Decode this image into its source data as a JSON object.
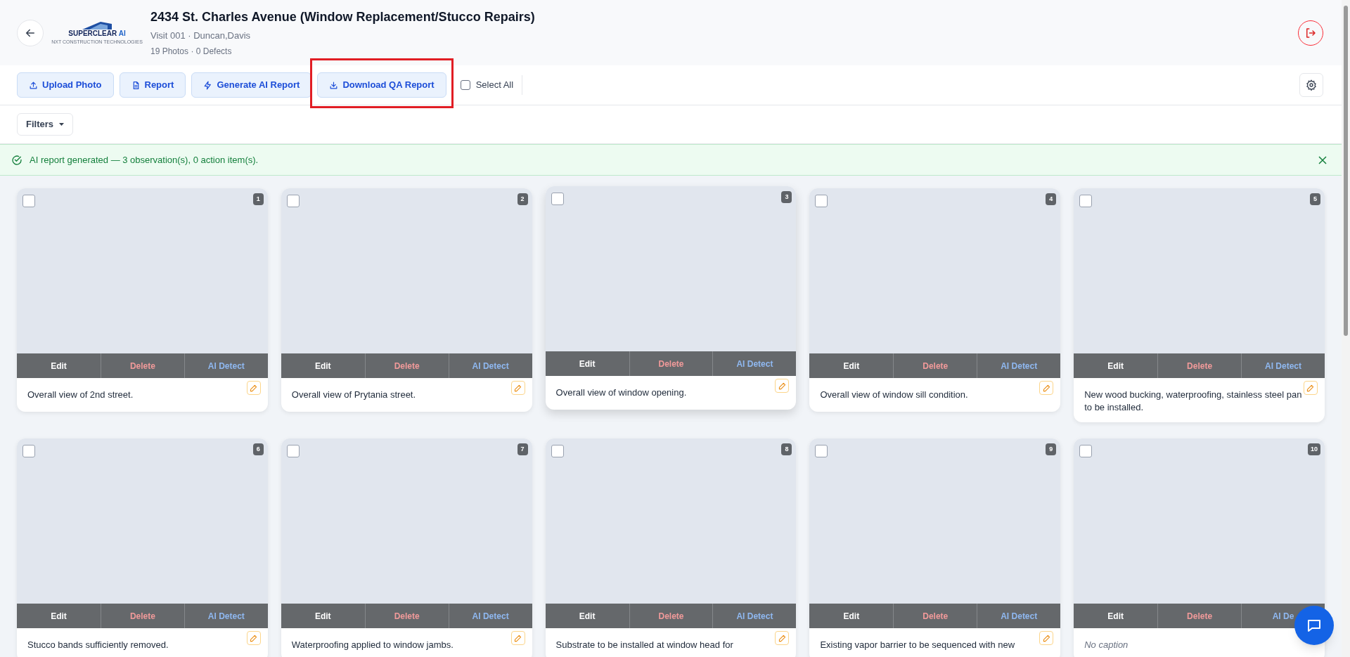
{
  "header": {
    "title": "2434 St. Charles Avenue (Window Replacement/Stucco Repairs)",
    "subtitle": "Visit 001 · Duncan,Davis",
    "stats": "19 Photos · 0 Defects",
    "logo": {
      "name": "SUPERCLEAR",
      "suffix": "AI",
      "tagline": "NXT CONSTRUCTION TECHNOLOGIES"
    }
  },
  "toolbar": {
    "buttons": [
      {
        "label": "Upload Photo",
        "kind": "upload",
        "highlighted": false
      },
      {
        "label": "Report",
        "kind": "document",
        "highlighted": false
      },
      {
        "label": "Generate AI Report",
        "kind": "bolt",
        "highlighted": false
      },
      {
        "label": "Download QA Report",
        "kind": "download",
        "highlighted": true
      }
    ],
    "select_all": {
      "label": "Select All",
      "checked": false
    }
  },
  "filters": {
    "label": "Filters"
  },
  "banner": {
    "kind": "success",
    "message": "AI report generated — 3 observation(s), 0 action item(s)."
  },
  "photos": [
    {
      "number": "1",
      "checked": false,
      "raised": false,
      "caption": "Overall view of 2nd street.",
      "caption_missing": false,
      "edit_icon": true,
      "actions": [
        {
          "kind": "edit",
          "label": "Edit"
        },
        {
          "kind": "delete",
          "label": "Delete"
        },
        {
          "kind": "detect",
          "label": "AI Detect"
        }
      ]
    },
    {
      "number": "2",
      "checked": false,
      "raised": false,
      "caption": "Overall view of Prytania street.",
      "caption_missing": false,
      "edit_icon": true,
      "actions": [
        {
          "kind": "edit",
          "label": "Edit"
        },
        {
          "kind": "delete",
          "label": "Delete"
        },
        {
          "kind": "detect",
          "label": "AI Detect"
        }
      ]
    },
    {
      "number": "3",
      "checked": false,
      "raised": true,
      "caption": "Overall view of window opening.",
      "caption_missing": false,
      "edit_icon": true,
      "actions": [
        {
          "kind": "edit",
          "label": "Edit"
        },
        {
          "kind": "delete",
          "label": "Delete"
        },
        {
          "kind": "detect",
          "label": "AI Detect"
        }
      ]
    },
    {
      "number": "4",
      "checked": false,
      "raised": false,
      "caption": "Overall view of window sill condition.",
      "caption_missing": false,
      "edit_icon": true,
      "actions": [
        {
          "kind": "edit",
          "label": "Edit"
        },
        {
          "kind": "delete",
          "label": "Delete"
        },
        {
          "kind": "detect",
          "label": "AI Detect"
        }
      ]
    },
    {
      "number": "5",
      "checked": false,
      "raised": false,
      "caption": "New wood bucking, waterproofing, stainless steel pan to be installed.",
      "caption_missing": false,
      "edit_icon": true,
      "actions": [
        {
          "kind": "edit",
          "label": "Edit"
        },
        {
          "kind": "delete",
          "label": "Delete"
        },
        {
          "kind": "detect",
          "label": "AI Detect"
        }
      ]
    },
    {
      "number": "6",
      "checked": false,
      "raised": false,
      "caption": "Stucco bands sufficiently removed.",
      "caption_missing": false,
      "edit_icon": true,
      "actions": [
        {
          "kind": "edit",
          "label": "Edit"
        },
        {
          "kind": "delete",
          "label": "Delete"
        },
        {
          "kind": "detect",
          "label": "AI Detect"
        }
      ]
    },
    {
      "number": "7",
      "checked": false,
      "raised": false,
      "caption": "Waterproofing applied to window jambs.",
      "caption_missing": false,
      "edit_icon": true,
      "actions": [
        {
          "kind": "edit",
          "label": "Edit"
        },
        {
          "kind": "delete",
          "label": "Delete"
        },
        {
          "kind": "detect",
          "label": "AI Detect"
        }
      ]
    },
    {
      "number": "8",
      "checked": false,
      "raised": false,
      "caption": "Substrate to be installed at window head for",
      "caption_missing": false,
      "edit_icon": true,
      "actions": [
        {
          "kind": "edit",
          "label": "Edit"
        },
        {
          "kind": "delete",
          "label": "Delete"
        },
        {
          "kind": "detect",
          "label": "AI Detect"
        }
      ]
    },
    {
      "number": "9",
      "checked": false,
      "raised": false,
      "caption": "Existing vapor barrier to be sequenced with new",
      "caption_missing": false,
      "edit_icon": true,
      "actions": [
        {
          "kind": "edit",
          "label": "Edit"
        },
        {
          "kind": "delete",
          "label": "Delete"
        },
        {
          "kind": "detect",
          "label": "AI Detect"
        }
      ]
    },
    {
      "number": "10",
      "checked": false,
      "raised": false,
      "caption": "No caption",
      "caption_missing": true,
      "edit_icon": false,
      "actions": [
        {
          "kind": "edit",
          "label": "Edit"
        },
        {
          "kind": "delete",
          "label": "Delete"
        },
        {
          "kind": "detect",
          "label": "AI De"
        }
      ]
    }
  ]
}
